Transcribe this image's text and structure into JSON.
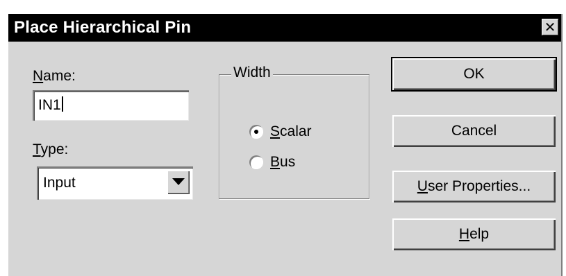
{
  "window": {
    "title": "Place Hierarchical Pin",
    "close_glyph": "✕"
  },
  "name_field": {
    "label_mnemonic": "N",
    "label_rest": "ame:",
    "value": "IN1"
  },
  "type_field": {
    "label_mnemonic": "T",
    "label_rest": "ype:",
    "selected": "Input"
  },
  "width_group": {
    "title": "Width",
    "options": [
      {
        "mnemonic": "S",
        "rest": "calar",
        "checked": true
      },
      {
        "mnemonic": "B",
        "rest": "us",
        "checked": false
      }
    ]
  },
  "buttons": {
    "ok": "OK",
    "cancel": "Cancel",
    "user_properties_mnemonic": "U",
    "user_properties_rest": "ser Properties...",
    "help_mnemonic": "H",
    "help_rest": "elp"
  },
  "icons": {
    "close": "close-icon",
    "dropdown": "chevron-down-icon"
  }
}
